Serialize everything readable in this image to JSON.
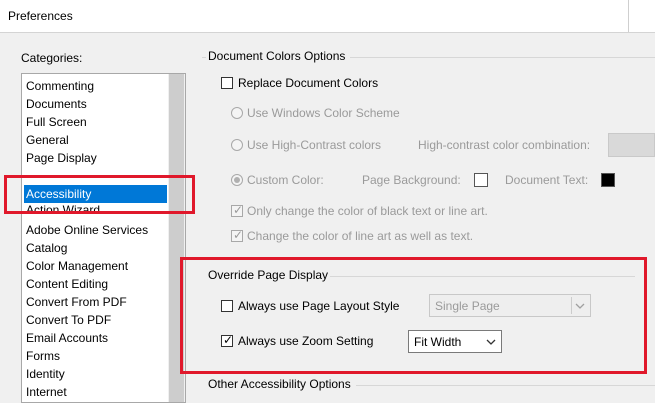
{
  "window": {
    "title": "Preferences"
  },
  "categories": {
    "label": "Categories:",
    "items": [
      "Commenting",
      "Documents",
      "Full Screen",
      "General",
      "Page Display",
      "Accessibility",
      "Action Wizard",
      "Adobe Online Services",
      "Catalog",
      "Color Management",
      "Content Editing",
      "Convert From PDF",
      "Convert To PDF",
      "Email Accounts",
      "Forms",
      "Identity",
      "Internet"
    ],
    "selected": "Accessibility"
  },
  "document_colors": {
    "title": "Document Colors Options",
    "replace_label": "Replace Document Colors",
    "windows_scheme_label": "Use Windows Color Scheme",
    "high_contrast_label": "Use High-Contrast colors",
    "combination_label": "High-contrast color combination:",
    "custom_color_label": "Custom Color:",
    "page_background_label": "Page Background:",
    "document_text_label": "Document Text:",
    "page_background_color": "#ffffff",
    "document_text_color": "#000000",
    "only_change_label": "Only change the color of black text or line art.",
    "change_line_art_label": "Change the color of line art as well as text."
  },
  "override_page_display": {
    "title": "Override Page Display",
    "layout_label": "Always use Page Layout Style",
    "layout_checked": false,
    "layout_value": "Single Page",
    "zoom_label": "Always use Zoom Setting",
    "zoom_checked": true,
    "zoom_value": "Fit Width"
  },
  "other_options": {
    "title": "Other Accessibility Options"
  },
  "colors": {
    "selection": "#0078d7",
    "highlight_box": "#e0182b"
  }
}
